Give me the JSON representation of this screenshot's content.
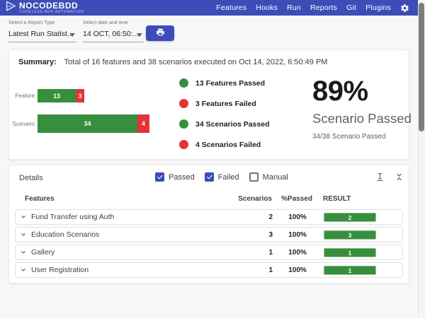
{
  "header": {
    "brand": {
      "name": "NOCODEBDD",
      "tagline": "CODELESS BDD AUTOMATION"
    },
    "nav": [
      "Features",
      "Hooks",
      "Run",
      "Reports",
      "Git",
      "Plugins"
    ]
  },
  "filters": {
    "report_type": {
      "label": "Select a Report Type",
      "value": "Latest Run Statist..."
    },
    "datetime": {
      "label": "Select date and time",
      "value": "14 OCT, 06:50:..."
    }
  },
  "summary": {
    "title": "Summary:",
    "text": "Total of 16 features and 38 scenarios executed on Oct 14, 2022, 6:50:49 PM",
    "legend": [
      {
        "label": "13 Features Passed",
        "color": "#388e3c"
      },
      {
        "label": "3 Features Failed",
        "color": "#e23437"
      },
      {
        "label": "34 Scenarios Passed",
        "color": "#388e3c"
      },
      {
        "label": "4 Scenarios Failed",
        "color": "#e23437"
      }
    ],
    "big_stat": {
      "percent": "89%",
      "label": "Scenario Passed",
      "sub": "34/38 Scenario Passed"
    }
  },
  "chart_data": {
    "type": "bar",
    "orientation": "horizontal",
    "stacked": true,
    "categories": [
      "Feature",
      "Scenario"
    ],
    "series": [
      {
        "name": "Passed",
        "color": "#388e3c",
        "values": [
          13,
          34
        ]
      },
      {
        "name": "Failed",
        "color": "#e23437",
        "values": [
          3,
          4
        ]
      }
    ],
    "totals": [
      16,
      38
    ],
    "legend_position": "right",
    "grid": false
  },
  "details": {
    "title": "Details",
    "filters": [
      {
        "label": "Passed",
        "checked": true
      },
      {
        "label": "Failed",
        "checked": true
      },
      {
        "label": "Manual",
        "checked": false
      }
    ],
    "table": {
      "headers": [
        "Features",
        "Scenarios",
        "%Passed",
        "RESULT"
      ],
      "rows": [
        {
          "feature": "Fund Transfer using Auth",
          "scenarios": "2",
          "percent": "100%",
          "result": "2"
        },
        {
          "feature": "Education Scenarios",
          "scenarios": "3",
          "percent": "100%",
          "result": "3"
        },
        {
          "feature": "Gallery",
          "scenarios": "1",
          "percent": "100%",
          "result": "1"
        },
        {
          "feature": "User Registration",
          "scenarios": "1",
          "percent": "100%",
          "result": "1"
        }
      ]
    }
  },
  "icons": {
    "logo": "code-play-triangle",
    "settings": "gear",
    "print": "printer",
    "select_caret": "caret-down",
    "scroll_action": "vertical-align-bottom",
    "collapse_action": "unfold-less",
    "row_expand": "chevron-down"
  },
  "colors": {
    "accent": "#3d4db7",
    "passed_green": "#388e3c",
    "failed_red": "#e23437",
    "page_background": "#f7f7f7",
    "card_background": "#ffffff"
  }
}
